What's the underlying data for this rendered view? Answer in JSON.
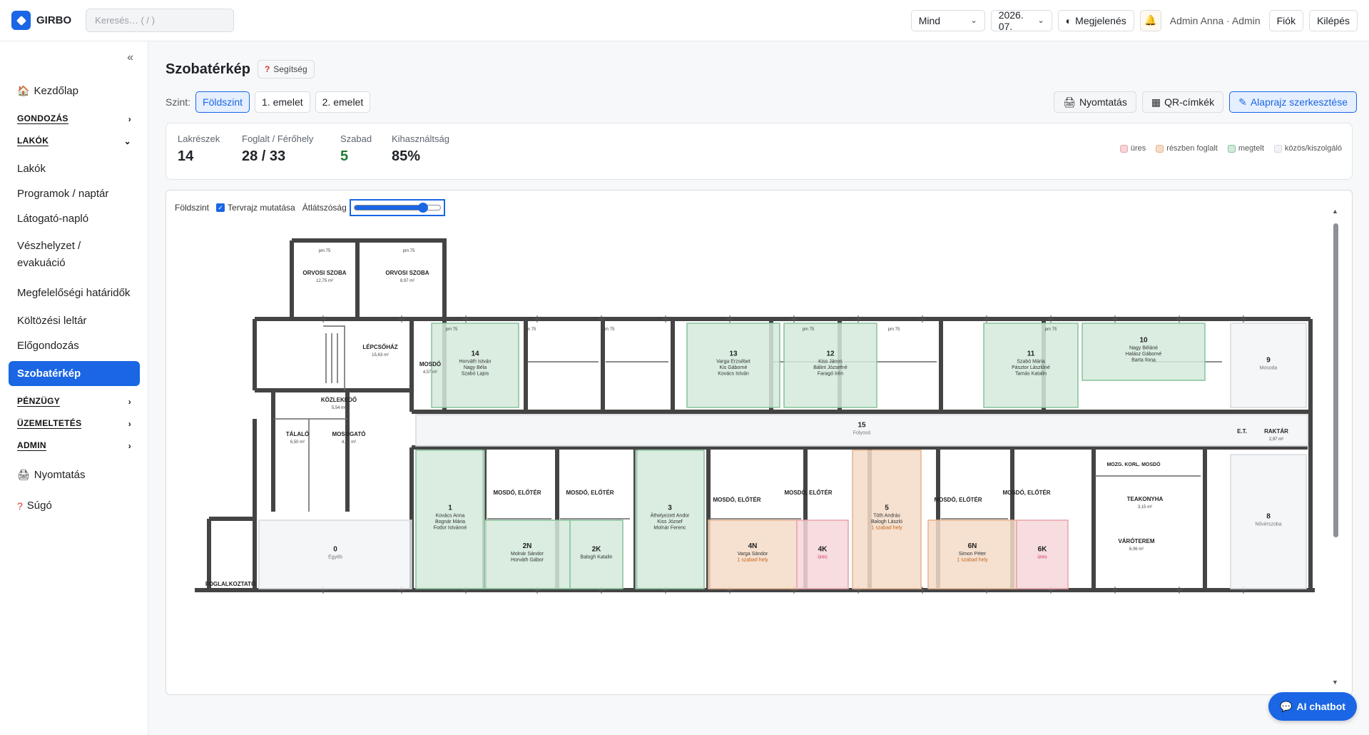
{
  "app": {
    "name": "GIRBO"
  },
  "search": {
    "placeholder": "Keresés… ( / )"
  },
  "topbar": {
    "filter": "Mind",
    "month": "2026. 07.",
    "appearance": "Megjelenés",
    "user": "Admin Anna · Admin",
    "account": "Fiók",
    "logout": "Kilépés"
  },
  "sidebar": {
    "home": "Kezdőlap",
    "gondozas": "GONDOZÁS",
    "lakok_section": "LAKÓK",
    "lakok": "Lakók",
    "programok": "Programok / naptár",
    "latogato": "Látogató-napló",
    "veszhelyzet": "Vészhelyzet / evakuáció",
    "megfelelosegi": "Megfelelőségi határidők",
    "koltozesi": "Költözési leltár",
    "elogondozas": "Előgondozás",
    "szobaterkep": "Szobatérkép",
    "penzugy": "PÉNZÜGY",
    "uzemeltetes": "ÜZEMELTETÉS",
    "admin": "ADMIN",
    "nyomtatas": "Nyomtatás",
    "sugo": "Súgó"
  },
  "page": {
    "title": "Szobatérkép",
    "help": "Segítség"
  },
  "levels": {
    "label": "Szint:",
    "items": [
      "Földszint",
      "1. emelet",
      "2. emelet"
    ],
    "active": 0
  },
  "actions": {
    "print": "Nyomtatás",
    "qr": "QR-címkék",
    "edit": "Alaprajz szerkesztése"
  },
  "stats": {
    "units_label": "Lakrészek",
    "units": "14",
    "occupied_label": "Foglalt / Férőhely",
    "occupied": "28 / 33",
    "free_label": "Szabad",
    "free": "5",
    "usage_label": "Kihasználtság",
    "usage": "85%"
  },
  "legend": {
    "empty": "üres",
    "partial": "részben foglalt",
    "full": "megtelt",
    "common": "közös/kiszolgáló"
  },
  "colors": {
    "empty": "#f6d6da",
    "partial": "#f5dcc8",
    "full": "#d3eadb",
    "common": "#f2f3f6",
    "accent": "#1a66e5",
    "free_green": "#237a36"
  },
  "plan": {
    "level": "Földszint",
    "show_plan": "Tervrajz mutatása",
    "opacity_label": "Átlátszóság",
    "opacity_value": 0.8,
    "plan_labels": {
      "orvosi": "ORVOSI SZOBA",
      "orvosi1_area": "12,75 m²",
      "orvosi2_area": "8,97 m²",
      "lepcsohaz": "LÉPCSŐHÁZ",
      "lepcsohaz_area": "15,63 m²",
      "mosdo": "MOSDÓ",
      "mosdo_area": "4,57 m²",
      "kozlekedo": "KÖZLEKEDŐ",
      "kozlekedo_area": "5,54 m²",
      "talalo": "TÁLALÓ",
      "talalo_area": "6,50 m²",
      "mosogato": "MOSOGATÓ",
      "mosogato_area": "4,78 m²",
      "foglalkoztato": "FOGLALKOZTATÓ",
      "mosdo_eloter": "MOSDÓ, ELŐTÉR",
      "varoterem": "VÁRÓTEREM",
      "varoterem_area": "6,06 m²",
      "teakonyha": "TEAKONYHA",
      "teakonyha_area": "3,15 m²",
      "raktar": "RAKTÁR",
      "raktar_area": "2,97 m²",
      "et": "E.T.",
      "mozg": "MOZG. KORL. MOSDÓ",
      "pm": "pm 75"
    },
    "rooms": [
      {
        "id": "14",
        "residents": [
          "Horváth István",
          "Nagy Béla",
          "Szabó Lajos"
        ],
        "status": "full"
      },
      {
        "id": "13",
        "residents": [
          "Varga Erzsébet",
          "Kis Gáborné",
          "Kovács István"
        ],
        "status": "full"
      },
      {
        "id": "12",
        "residents": [
          "Kiss János",
          "Bálint Józsefné",
          "Faragó Irén"
        ],
        "status": "full"
      },
      {
        "id": "11",
        "residents": [
          "Szabó Mária",
          "Pásztor Lászlóné",
          "Tamás Katalin"
        ],
        "status": "full"
      },
      {
        "id": "10",
        "residents": [
          "Nagy Béláné",
          "Halász Gáborné",
          "Barta Ilona"
        ],
        "status": "full"
      },
      {
        "id": "9",
        "name": "Mosoda",
        "status": "common"
      },
      {
        "id": "15",
        "name": "Folyosó",
        "status": "common"
      },
      {
        "id": "0",
        "name": "Egyéb",
        "status": "common"
      },
      {
        "id": "1",
        "residents": [
          "Kovács Anna",
          "Bognár Mária",
          "Fodor Istvánné"
        ],
        "status": "full"
      },
      {
        "id": "2N",
        "residents": [
          "Molnár Sándor",
          "Horváth Gábor"
        ],
        "status": "full"
      },
      {
        "id": "2K",
        "residents": [
          "Balogh Katalin"
        ],
        "status": "full"
      },
      {
        "id": "3",
        "residents": [
          "Áthelyezett Andor",
          "Kiss József",
          "Molnár Ferenc"
        ],
        "status": "full"
      },
      {
        "id": "4N",
        "residents": [
          "Varga Sándor"
        ],
        "note": "1 szabad hely",
        "status": "partial"
      },
      {
        "id": "4K",
        "note": "üres",
        "status": "empty"
      },
      {
        "id": "5",
        "residents": [
          "Tóth András",
          "Balogh László"
        ],
        "note": "1 szabad hely",
        "status": "partial"
      },
      {
        "id": "6N",
        "residents": [
          "Simon Péter"
        ],
        "note": "1 szabad hely",
        "status": "partial"
      },
      {
        "id": "6K",
        "note": "üres",
        "status": "empty"
      },
      {
        "id": "8",
        "name": "Nővérszoba",
        "status": "common"
      }
    ]
  },
  "chatbot": "AI chatbot"
}
